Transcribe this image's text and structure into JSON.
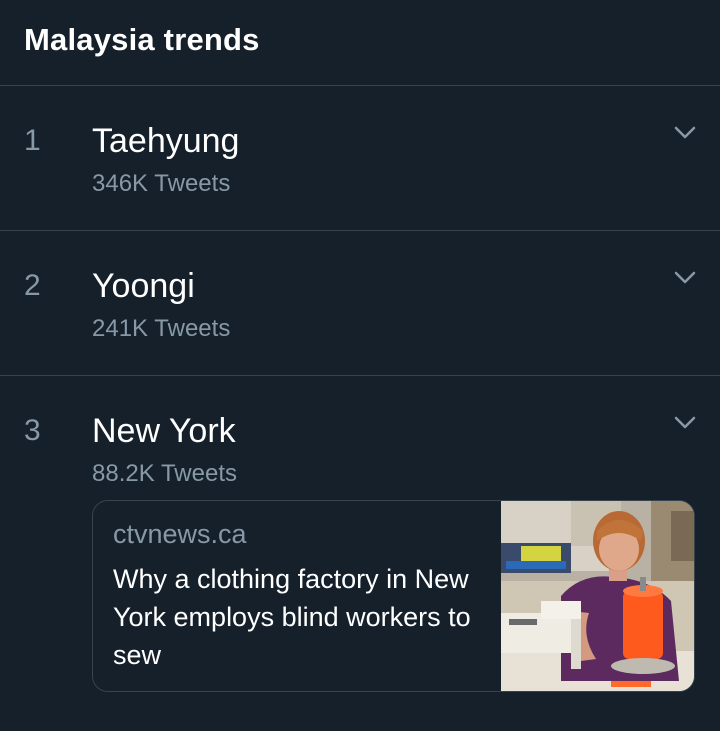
{
  "header": {
    "title": "Malaysia trends"
  },
  "trends": [
    {
      "rank": "1",
      "name": "Taehyung",
      "count": "346K Tweets"
    },
    {
      "rank": "2",
      "name": "Yoongi",
      "count": "241K Tweets"
    },
    {
      "rank": "3",
      "name": "New York",
      "count": "88.2K Tweets"
    }
  ],
  "card": {
    "source": "ctvnews.ca",
    "headline": "Why a clothing factory in New York employs blind workers to sew",
    "thumbnail": "woman-at-sewing-machine-photo"
  },
  "icons": {
    "caret": "chevron-down-icon"
  },
  "colors": {
    "background": "#15202b",
    "divider": "#38444d",
    "secondary_text": "#8899a6",
    "primary_text": "#ffffff"
  }
}
